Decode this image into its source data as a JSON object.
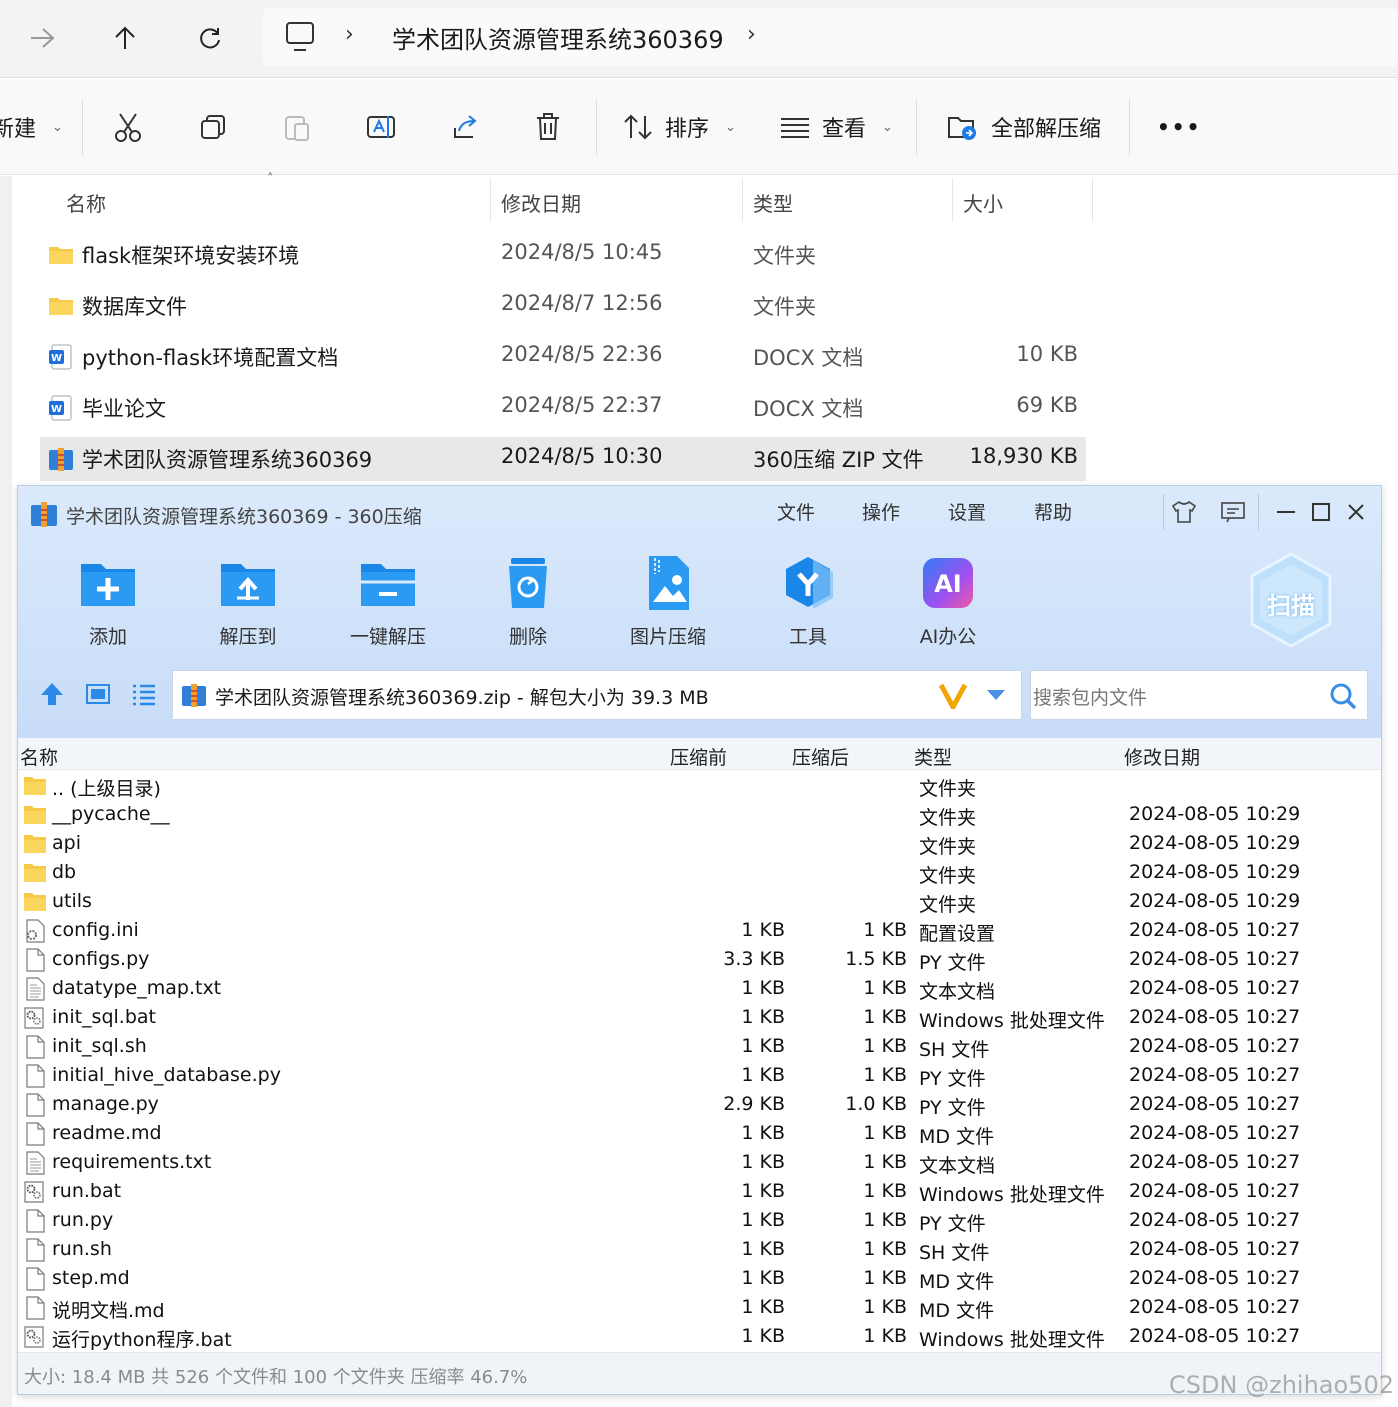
{
  "explorer": {
    "breadcrumb": "学术团队资源管理系统360369",
    "toolbar": {
      "new_label": "新建",
      "sort_label": "排序",
      "view_label": "查看",
      "extract_all_label": "全部解压缩",
      "more_label": "•••"
    },
    "columns": {
      "name": "名称",
      "modified": "修改日期",
      "type": "类型",
      "size": "大小"
    },
    "files": [
      {
        "name": "flask框架环境安装环境",
        "modified": "2024/8/5 10:45",
        "type": "文件夹",
        "size": "",
        "icon": "folder-icon"
      },
      {
        "name": "数据库文件",
        "modified": "2024/8/7 12:56",
        "type": "文件夹",
        "size": "",
        "icon": "folder-icon"
      },
      {
        "name": "python-flask环境配置文档",
        "modified": "2024/8/5 22:36",
        "type": "DOCX 文档",
        "size": "10 KB",
        "icon": "word-doc-icon"
      },
      {
        "name": "毕业论文",
        "modified": "2024/8/5 22:37",
        "type": "DOCX 文档",
        "size": "69 KB",
        "icon": "word-doc-icon"
      },
      {
        "name": "学术团队资源管理系统360369",
        "modified": "2024/8/5 10:30",
        "type": "360压缩 ZIP 文件",
        "size": "18,930 KB",
        "icon": "zip-archive-icon"
      }
    ]
  },
  "zipwin": {
    "title": "学术团队资源管理系统360369 - 360压缩",
    "menu": [
      "文件",
      "操作",
      "设置",
      "帮助"
    ],
    "tools": [
      "添加",
      "解压到",
      "一键解压",
      "删除",
      "图片压缩",
      "工具",
      "AI办公"
    ],
    "scan_label": "扫描",
    "path": "学术团队资源管理系统360369.zip - 解包大小为 39.3 MB",
    "search_placeholder": "搜索包内文件",
    "columns": {
      "name": "名称",
      "before": "压缩前",
      "after": "压缩后",
      "type": "类型",
      "modified": "修改日期"
    },
    "rows": [
      {
        "name": ".. (上级目录)",
        "before": "",
        "after": "",
        "type": "文件夹",
        "modified": "",
        "icon": "folder"
      },
      {
        "name": "__pycache__",
        "before": "",
        "after": "",
        "type": "文件夹",
        "modified": "2024-08-05 10:29",
        "icon": "folder"
      },
      {
        "name": "api",
        "before": "",
        "after": "",
        "type": "文件夹",
        "modified": "2024-08-05 10:29",
        "icon": "folder"
      },
      {
        "name": "db",
        "before": "",
        "after": "",
        "type": "文件夹",
        "modified": "2024-08-05 10:29",
        "icon": "folder"
      },
      {
        "name": "utils",
        "before": "",
        "after": "",
        "type": "文件夹",
        "modified": "2024-08-05 10:29",
        "icon": "folder"
      },
      {
        "name": "config.ini",
        "before": "1 KB",
        "after": "1 KB",
        "type": "配置设置",
        "modified": "2024-08-05 10:27",
        "icon": "config"
      },
      {
        "name": "configs.py",
        "before": "3.3 KB",
        "after": "1.5 KB",
        "type": "PY 文件",
        "modified": "2024-08-05 10:27",
        "icon": "file"
      },
      {
        "name": "datatype_map.txt",
        "before": "1 KB",
        "after": "1 KB",
        "type": "文本文档",
        "modified": "2024-08-05 10:27",
        "icon": "text"
      },
      {
        "name": "init_sql.bat",
        "before": "1 KB",
        "after": "1 KB",
        "type": "Windows 批处理文件",
        "modified": "2024-08-05 10:27",
        "icon": "bat"
      },
      {
        "name": "init_sql.sh",
        "before": "1 KB",
        "after": "1 KB",
        "type": "SH 文件",
        "modified": "2024-08-05 10:27",
        "icon": "file"
      },
      {
        "name": "initial_hive_database.py",
        "before": "1 KB",
        "after": "1 KB",
        "type": "PY 文件",
        "modified": "2024-08-05 10:27",
        "icon": "file"
      },
      {
        "name": "manage.py",
        "before": "2.9 KB",
        "after": "1.0 KB",
        "type": "PY 文件",
        "modified": "2024-08-05 10:27",
        "icon": "file"
      },
      {
        "name": "readme.md",
        "before": "1 KB",
        "after": "1 KB",
        "type": "MD 文件",
        "modified": "2024-08-05 10:27",
        "icon": "file"
      },
      {
        "name": "requirements.txt",
        "before": "1 KB",
        "after": "1 KB",
        "type": "文本文档",
        "modified": "2024-08-05 10:27",
        "icon": "text"
      },
      {
        "name": "run.bat",
        "before": "1 KB",
        "after": "1 KB",
        "type": "Windows 批处理文件",
        "modified": "2024-08-05 10:27",
        "icon": "bat"
      },
      {
        "name": "run.py",
        "before": "1 KB",
        "after": "1 KB",
        "type": "PY 文件",
        "modified": "2024-08-05 10:27",
        "icon": "file"
      },
      {
        "name": "run.sh",
        "before": "1 KB",
        "after": "1 KB",
        "type": "SH 文件",
        "modified": "2024-08-05 10:27",
        "icon": "file"
      },
      {
        "name": "step.md",
        "before": "1 KB",
        "after": "1 KB",
        "type": "MD 文件",
        "modified": "2024-08-05 10:27",
        "icon": "file"
      },
      {
        "name": "说明文档.md",
        "before": "1 KB",
        "after": "1 KB",
        "type": "MD 文件",
        "modified": "2024-08-05 10:27",
        "icon": "file"
      },
      {
        "name": "运行python程序.bat",
        "before": "1 KB",
        "after": "1 KB",
        "type": "Windows 批处理文件",
        "modified": "2024-08-05 10:27",
        "icon": "bat"
      }
    ],
    "status": "大小: 18.4 MB 共 526 个文件和 100 个文件夹 压缩率 46.7%"
  },
  "watermark": "CSDN @zhihao502",
  "colors": {
    "accent": "#1e7be6",
    "folder": "#f7c948",
    "zipwin_bg": "#d3e4fa",
    "selection": "#e8e8e8"
  }
}
